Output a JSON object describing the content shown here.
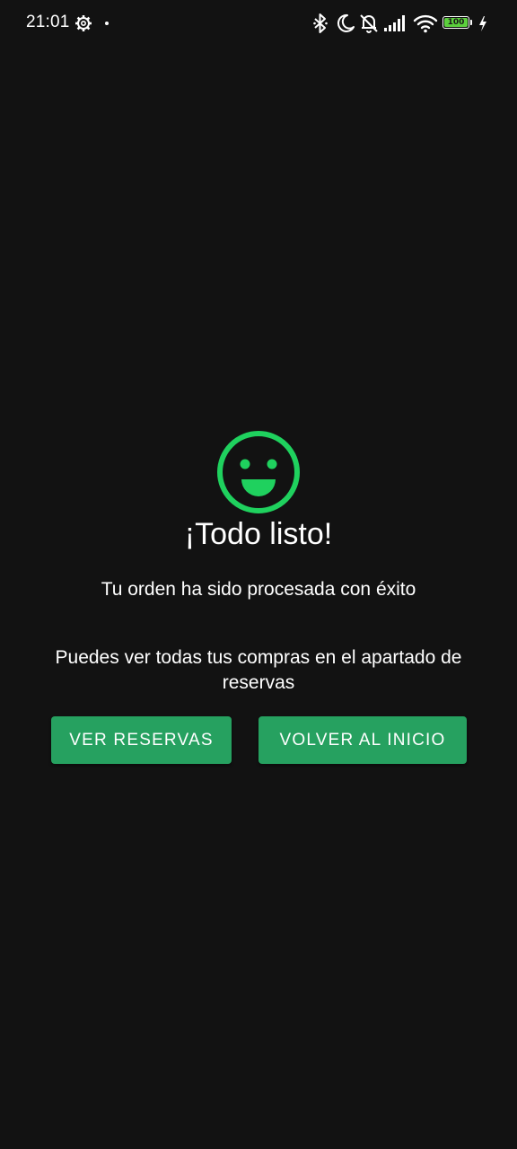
{
  "status_bar": {
    "time": "21:01",
    "battery_level": "100",
    "icons": [
      "gear-icon",
      "bluetooth-icon",
      "moon-icon",
      "bell-off-icon",
      "signal-icon",
      "wifi-icon",
      "battery-icon",
      "charging-bolt-icon"
    ]
  },
  "colors": {
    "background": "#121212",
    "accent": "#26a160",
    "smiley": "#1fd15e",
    "battery": "#5ccf3d"
  },
  "main": {
    "icon": "smiley-icon",
    "title": "¡Todo listo!",
    "subtitle": "Tu orden ha sido procesada con éxito",
    "info": "Puedes ver todas tus compras en el apartado de reservas",
    "buttons": {
      "reservas_label": "VER RESERVAS",
      "inicio_label": "VOLVER AL INICIO"
    }
  }
}
